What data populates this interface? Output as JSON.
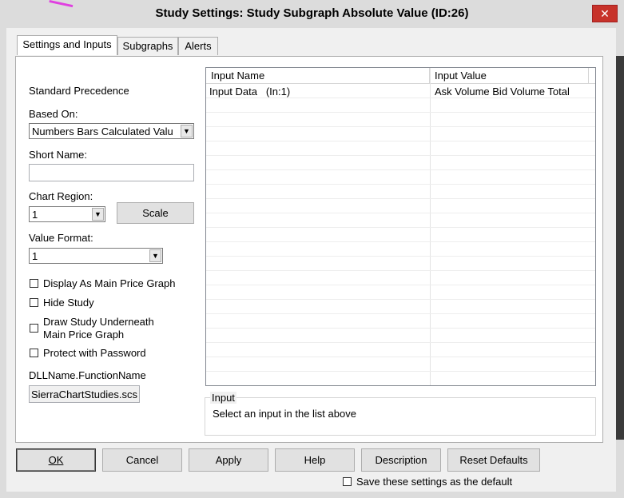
{
  "window": {
    "title": "Study Settings: Study Subgraph Absolute Value (ID:26)",
    "close_glyph": "✕"
  },
  "tabs": [
    {
      "label": "Settings and Inputs",
      "active": true
    },
    {
      "label": "Subgraphs",
      "active": false
    },
    {
      "label": "Alerts",
      "active": false
    }
  ],
  "settings": {
    "standard_precedence": "Standard Precedence",
    "based_on_label": "Based On:",
    "based_on_value": "Numbers Bars Calculated Valu",
    "short_name_label": "Short Name:",
    "short_name_value": "",
    "chart_region_label": "Chart Region:",
    "chart_region_value": "1",
    "scale_button": "Scale",
    "value_format_label": "Value Format:",
    "value_format_value": "1",
    "checkboxes": [
      {
        "label": "Display As Main Price Graph",
        "checked": false
      },
      {
        "label": "Hide Study",
        "checked": false
      },
      {
        "label": "Draw Study Underneath",
        "label2": "Main Price Graph",
        "checked": false
      },
      {
        "label": "Protect with Password",
        "checked": false
      }
    ],
    "dll_label": "DLLName.FunctionName",
    "dll_value": "SierraChartStudies.scs"
  },
  "inputs_grid": {
    "columns": [
      "Input Name",
      "Input Value"
    ],
    "rows": [
      {
        "name": "Input Data   (In:1)",
        "value": "Ask Volume Bid Volume Total"
      }
    ]
  },
  "input_group": {
    "title": "Input",
    "text": "Select an input in the list above"
  },
  "footer": {
    "ok": "OK",
    "cancel": "Cancel",
    "apply": "Apply",
    "help": "Help",
    "description": "Description",
    "reset_defaults": "Reset Defaults",
    "save_default_label": "Save these settings as the default",
    "save_default_checked": false
  }
}
